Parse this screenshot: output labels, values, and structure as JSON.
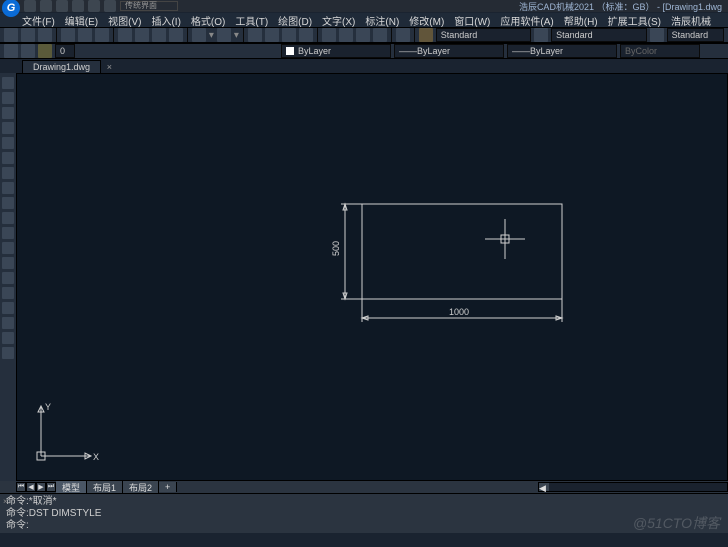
{
  "title": "浩辰CAD机械2021 （标准：GB） - [Drawing1.dwg",
  "qat_dropdown": "传统界面",
  "menus": [
    "文件(F)",
    "编辑(E)",
    "视图(V)",
    "插入(I)",
    "格式(O)",
    "工具(T)",
    "绘图(D)",
    "文字(X)",
    "标注(N)",
    "修改(M)",
    "窗口(W)",
    "应用软件(A)",
    "帮助(H)",
    "扩展工具(S)",
    "浩辰机械"
  ],
  "props": {
    "style1": "Standard",
    "style2": "Standard",
    "style3": "Standard",
    "layer": "0",
    "bylayer1": "ByLayer",
    "bylayer2": "ByLayer",
    "bylayer3": "ByLayer",
    "bycolor": "ByColor"
  },
  "tab": "Drawing1.dwg",
  "dims": {
    "v": "500",
    "h": "1000"
  },
  "ucs": {
    "y": "Y",
    "x": "X"
  },
  "btabs": {
    "model": "模型",
    "l1": "布局1",
    "l2": "布局2",
    "plus": "+"
  },
  "cmd": {
    "l1": "命令:*取消*",
    "l2": "命令:DST DIMSTYLE",
    "l3": "命令:"
  },
  "watermark": "@51CTO博客"
}
